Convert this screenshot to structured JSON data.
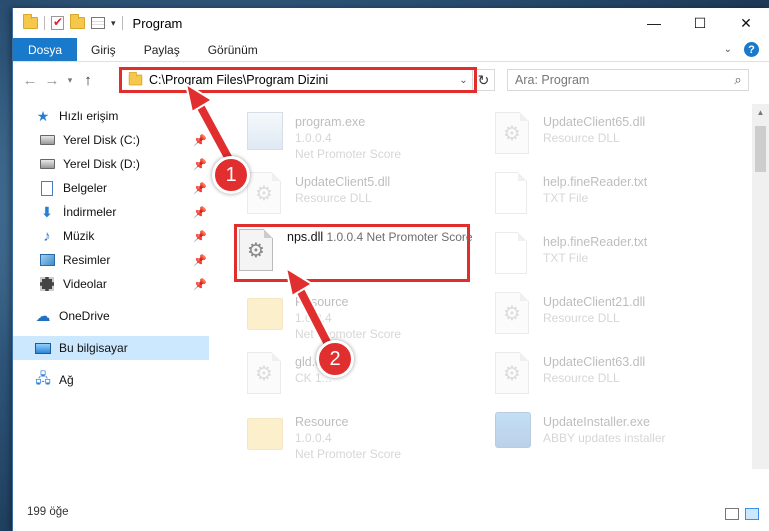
{
  "window": {
    "title": "Program",
    "controls": {
      "minimize": "—",
      "maximize": "☐",
      "close": "✕"
    }
  },
  "ribbon": {
    "tabs": [
      {
        "label": "Dosya",
        "active": true
      },
      {
        "label": "Giriş"
      },
      {
        "label": "Paylaş"
      },
      {
        "label": "Görünüm"
      }
    ],
    "help": "?"
  },
  "nav": {
    "address": "C:\\Program Files\\Program Dizini",
    "search_placeholder": "Ara: Program"
  },
  "sidebar": {
    "items": [
      {
        "label": "Hızlı erişim",
        "icon": "star-icon",
        "pinned": false,
        "top": true
      },
      {
        "label": "Yerel Disk (C:)",
        "icon": "disk-icon",
        "pinned": true
      },
      {
        "label": "Yerel Disk (D:)",
        "icon": "disk-icon",
        "pinned": true
      },
      {
        "label": "Belgeler",
        "icon": "documents-icon",
        "pinned": true
      },
      {
        "label": "İndirmeler",
        "icon": "downloads-icon",
        "pinned": true
      },
      {
        "label": "Müzik",
        "icon": "music-icon",
        "pinned": true
      },
      {
        "label": "Resimler",
        "icon": "pictures-icon",
        "pinned": true
      },
      {
        "label": "Videolar",
        "icon": "videos-icon",
        "pinned": true
      },
      {
        "label": "OneDrive",
        "icon": "cloud-icon",
        "top": true
      },
      {
        "label": "Bu bilgisayar",
        "icon": "computer-icon",
        "top": true,
        "selected": true
      },
      {
        "label": "Ağ",
        "icon": "network-icon",
        "top": true
      }
    ]
  },
  "files": {
    "left": [
      {
        "name": "program.exe",
        "line2": "1.0.0.4",
        "line3": "Net Promoter Score",
        "icon": "exe-icon"
      },
      {
        "name": "UpdateClient5.dll",
        "line2": "Resource DLL",
        "icon": "dll-icon"
      },
      {
        "name": "Resource",
        "line2": "1.0.0.4",
        "line3": "Net Promoter Score",
        "icon": "folder-icon"
      },
      {
        "name": "gld.d...",
        "line2": "CK 1...",
        "icon": "dll-icon"
      },
      {
        "name": "Resource",
        "line2": "1.0.0.4",
        "line3": "Net Promoter Score",
        "icon": "folder-icon"
      }
    ],
    "right": [
      {
        "name": "UpdateClient65.dll",
        "line2": "Resource DLL",
        "icon": "dll-icon"
      },
      {
        "name": "help.fineReader.txt",
        "line2": "TXT File",
        "icon": "text-file-icon"
      },
      {
        "name": "help.fineReader.txt",
        "line2": "TXT File",
        "icon": "text-file-icon"
      },
      {
        "name": "UpdateClient21.dll",
        "line2": "Resource DLL",
        "icon": "dll-icon"
      },
      {
        "name": "UpdateClient63.dll",
        "line2": "Resource DLL",
        "icon": "dll-icon"
      },
      {
        "name": "UpdateInstaller.exe",
        "line2": "ABBY updates installer",
        "icon": "installer-icon"
      }
    ],
    "highlighted": {
      "name": "nps.dll",
      "line2": "1.0.0.4",
      "line3": "Net Promoter Score",
      "icon": "dll-icon"
    }
  },
  "status": {
    "count": "199 öğe"
  },
  "annotations": {
    "step1": "1",
    "step2": "2",
    "color": "#e12e2e"
  }
}
